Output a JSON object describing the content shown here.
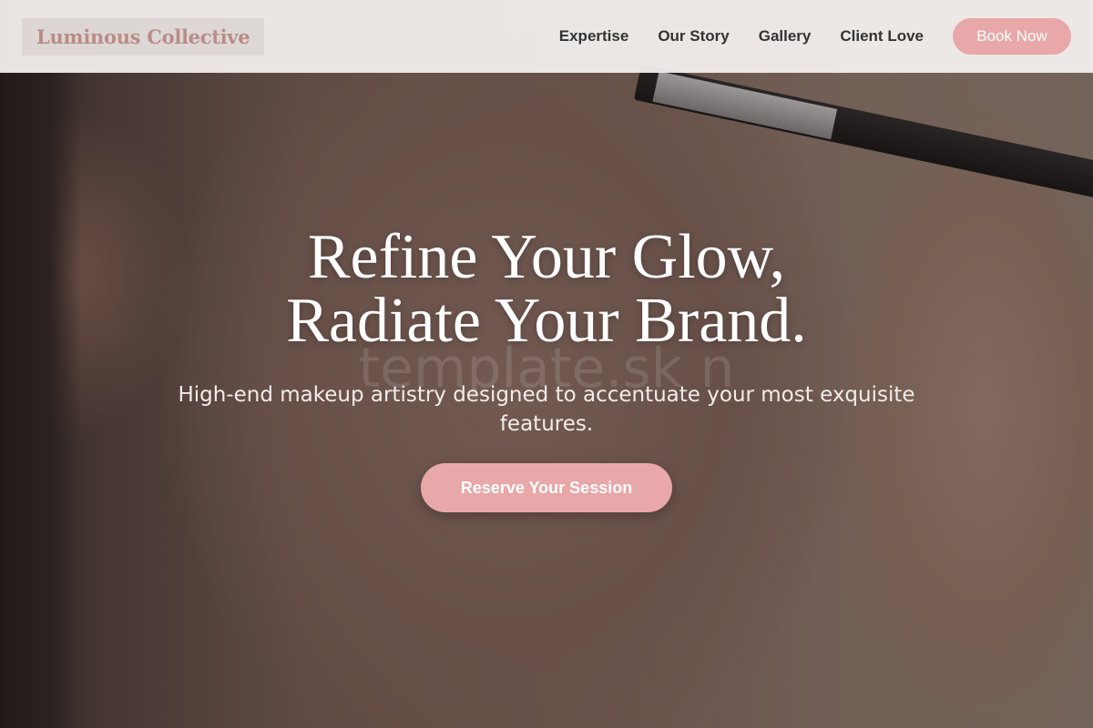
{
  "header": {
    "logo": "Luminous Collective",
    "nav": [
      {
        "label": "Expertise"
      },
      {
        "label": "Our Story"
      },
      {
        "label": "Gallery"
      },
      {
        "label": "Client Love"
      }
    ],
    "cta_label": "Book Now"
  },
  "hero": {
    "headline_line1": "Refine Your Glow,",
    "headline_line2": "Radiate Your Brand.",
    "watermark": "template.sk n",
    "subtitle": "High-end makeup artistry designed to accentuate your most exquisite features.",
    "cta_label": "Reserve Your Session",
    "image_description_icon": "makeup-portrait-image"
  },
  "colors": {
    "accent": "#e8a7a8",
    "logo": "#b88c88",
    "nav_text": "#333333",
    "header_bg": "#f5f2f0"
  }
}
